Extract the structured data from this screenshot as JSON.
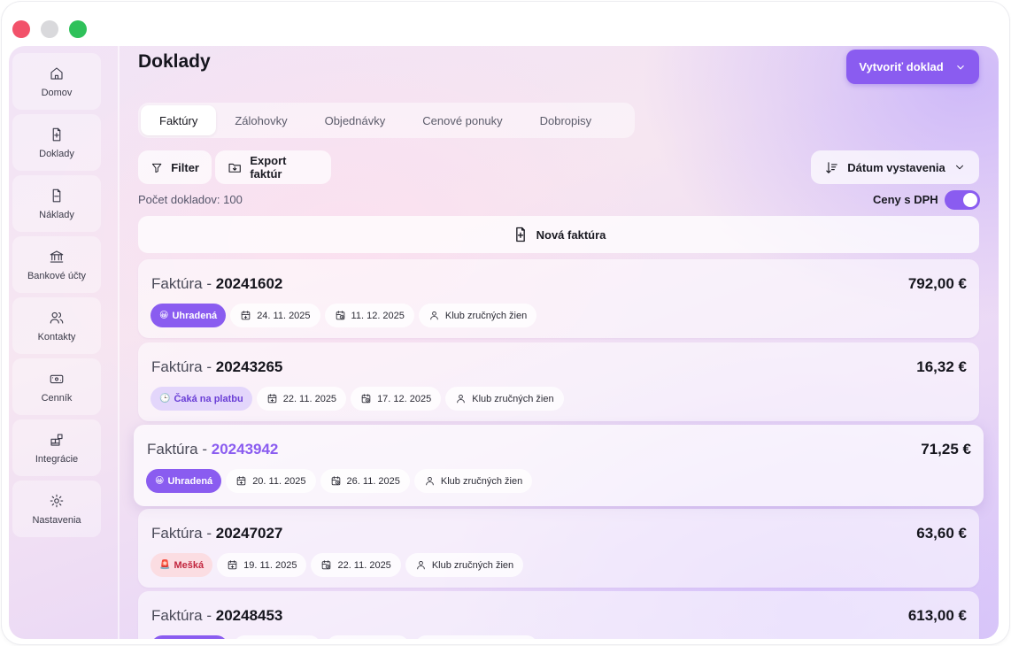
{
  "window": {
    "controls": [
      "close",
      "minimize",
      "maximize"
    ]
  },
  "sidebar": {
    "items": [
      {
        "label": "Domov",
        "icon": "home-icon"
      },
      {
        "label": "Doklady",
        "icon": "document-plus-icon"
      },
      {
        "label": "Náklady",
        "icon": "document-minus-icon"
      },
      {
        "label": "Bankové účty",
        "icon": "bank-icon"
      },
      {
        "label": "Kontakty",
        "icon": "users-icon"
      },
      {
        "label": "Cenník",
        "icon": "banknote-icon"
      },
      {
        "label": "Integrácie",
        "icon": "blocks-icon"
      },
      {
        "label": "Nastavenia",
        "icon": "gear-icon"
      }
    ]
  },
  "header": {
    "title": "Doklady",
    "create_button": "Vytvoriť doklad"
  },
  "tabs": [
    {
      "label": "Faktúry",
      "active": true
    },
    {
      "label": "Zálohovky",
      "active": false
    },
    {
      "label": "Objednávky",
      "active": false
    },
    {
      "label": "Cenové ponuky",
      "active": false
    },
    {
      "label": "Dobropisy",
      "active": false
    }
  ],
  "toolbar": {
    "filter_label": "Filter",
    "export_label": "Export faktúr",
    "sort_label": "Dátum vystavenia"
  },
  "summary": {
    "count_text": "Počet dokladov: 100",
    "vat_label": "Ceny s DPH",
    "vat_enabled": true
  },
  "new_invoice_label": "Nová faktúra",
  "colors": {
    "accent": "#8a5cf0",
    "waiting_bg": "#e3d6fb",
    "late_bg": "#fbdde2",
    "late_text": "#c2253e"
  },
  "invoices": [
    {
      "prefix": "Faktúra - ",
      "number": "20241602",
      "amount": "792,00 €",
      "status": "Uhradená",
      "status_emoji": "😀",
      "status_type": "paid",
      "issued": "24. 11. 2025",
      "due": "11. 12. 2025",
      "client": "Klub zručných žien"
    },
    {
      "prefix": "Faktúra - ",
      "number": "20243265",
      "amount": "16,32 €",
      "status": "Čaká na platbu",
      "status_emoji": "🕒",
      "status_type": "waiting",
      "issued": "22. 11. 2025",
      "due": "17. 12. 2025",
      "client": "Klub zručných žien"
    },
    {
      "prefix": "Faktúra - ",
      "number": "20243942",
      "amount": "71,25 €",
      "status": "Uhradená",
      "status_emoji": "😀",
      "status_type": "paid",
      "issued": "20. 11. 2025",
      "due": "26. 11. 2025",
      "client": "Klub zručných žien"
    },
    {
      "prefix": "Faktúra - ",
      "number": "20247027",
      "amount": "63,60 €",
      "status": "Mešká",
      "status_emoji": "🚨",
      "status_type": "late",
      "issued": "19. 11. 2025",
      "due": "22. 11. 2025",
      "client": "Klub zručných žien"
    },
    {
      "prefix": "Faktúra - ",
      "number": "20248453",
      "amount": "613,00 €"
    }
  ]
}
